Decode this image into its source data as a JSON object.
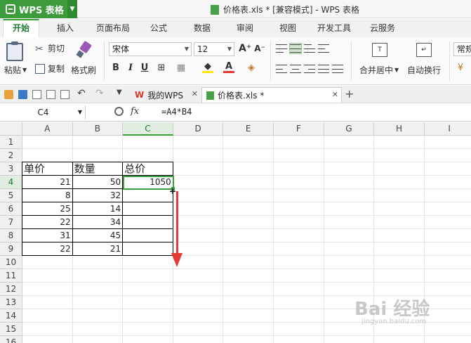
{
  "titlebar": {
    "app_name": "WPS 表格",
    "doc_title": "价格表.xls * [兼容模式] - WPS 表格"
  },
  "ribbon_tabs": [
    "开始",
    "插入",
    "页面布局",
    "公式",
    "数据",
    "审阅",
    "视图",
    "开发工具",
    "云服务"
  ],
  "ribbon": {
    "paste": "粘贴",
    "cut": "剪切",
    "copy": "复制",
    "format_painter": "格式刷",
    "font_name": "宋体",
    "font_size": "12",
    "bold": "B",
    "italic": "I",
    "underline": "U",
    "merge_center": "合并居中",
    "wrap_text": "自动换行",
    "number_format": "常规"
  },
  "doc_tabs": [
    {
      "label": "我的WPS"
    },
    {
      "label": "价格表.xls *"
    }
  ],
  "formula_bar": {
    "name_box": "C4",
    "fx": "fx",
    "formula": "=A4*B4"
  },
  "columns": [
    "A",
    "B",
    "C",
    "D",
    "E",
    "F",
    "G",
    "H",
    "I"
  ],
  "rows": [
    "1",
    "2",
    "3",
    "4",
    "5",
    "6",
    "7",
    "8",
    "9",
    "10",
    "11",
    "12",
    "13",
    "14",
    "15",
    "16"
  ],
  "table": {
    "headers": [
      "单价",
      "数量",
      "总价"
    ],
    "rows": [
      [
        "21",
        "50",
        "1050"
      ],
      [
        "8",
        "32",
        ""
      ],
      [
        "25",
        "14",
        ""
      ],
      [
        "22",
        "34",
        ""
      ],
      [
        "31",
        "45",
        ""
      ],
      [
        "22",
        "21",
        ""
      ]
    ]
  },
  "watermark": {
    "text": "Bai 经验",
    "sub": "jingyan.baidu.com"
  },
  "colors": {
    "accent": "#3d9b3d",
    "annotation_arrow": "#e53935"
  }
}
